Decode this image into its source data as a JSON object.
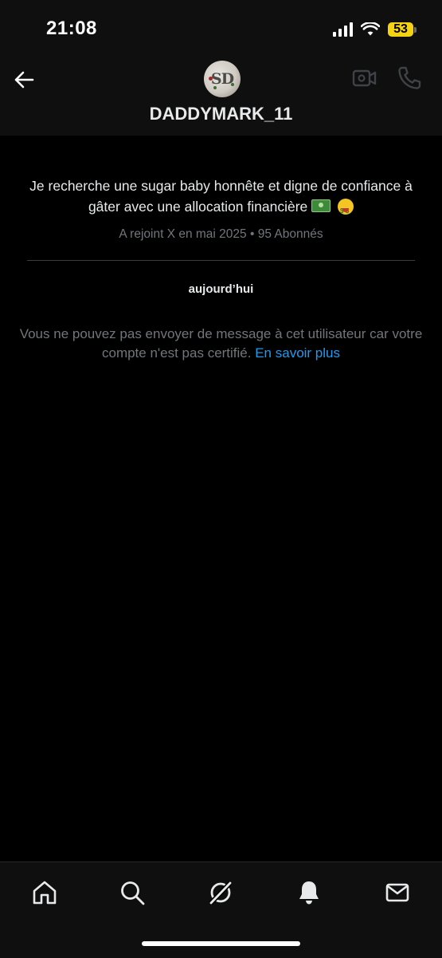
{
  "status_bar": {
    "time": "21:08",
    "battery_level": "53",
    "battery_color": "#f5d311"
  },
  "header": {
    "back_icon": "arrow-left-icon",
    "avatar_text": "SD",
    "username": "DADDYMARK_11",
    "video_call_icon": "video-camera-icon",
    "phone_call_icon": "phone-icon"
  },
  "profile": {
    "bio_text": "Je recherche une sugar baby honnête et digne de confiance à gâter avec une allocation financière",
    "bio_emojis": [
      "cash-icon",
      "money-mouth-face-icon"
    ],
    "meta": "A rejoint X en mai 2025 • 95 Abonnés"
  },
  "conversation": {
    "day_label": "aujourd’hui",
    "notice": "Vous ne pouvez pas envoyer de message à cet utilisateur car votre compte n'est pas certifié.",
    "learn_more": "En savoir plus",
    "link_color": "#1d9bf0"
  },
  "tab_bar": {
    "items": [
      {
        "icon": "home-icon"
      },
      {
        "icon": "search-icon"
      },
      {
        "icon": "grok-icon"
      },
      {
        "icon": "bell-icon"
      },
      {
        "icon": "mail-icon"
      }
    ]
  }
}
